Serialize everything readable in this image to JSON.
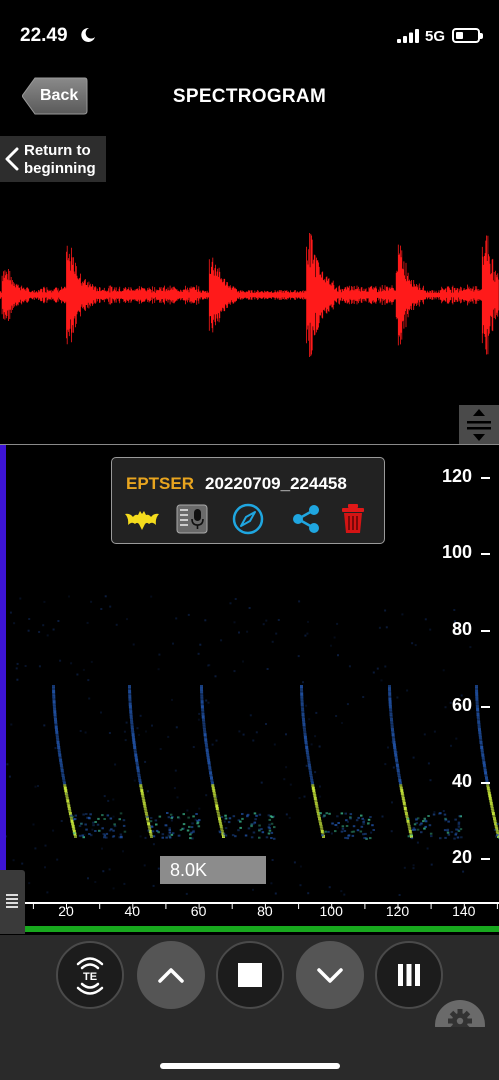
{
  "status_bar": {
    "time": "22.49",
    "network": "5G"
  },
  "nav": {
    "back_label": "Back",
    "title": "SPECTROGRAM"
  },
  "return_button": {
    "line1": "Return to",
    "line2": "beginning"
  },
  "recording": {
    "species_code": "EPTSER",
    "file_id": "20220709_224458",
    "actions": [
      "bat-icon",
      "recorder-icon",
      "compass-icon",
      "share-icon",
      "trash-icon"
    ]
  },
  "frequency_axis": {
    "labels": [
      "120",
      "100",
      "80",
      "60",
      "40",
      "20"
    ]
  },
  "sample_rate_label": "8.0K",
  "time_axis": {
    "labels": [
      "20",
      "40",
      "60",
      "80",
      "100",
      "120",
      "140"
    ]
  },
  "toolbar": {
    "buttons": [
      "te-listen-icon",
      "zoom-in-chevron-up-icon",
      "stop-icon",
      "zoom-out-chevron-down-icon",
      "columns-icon"
    ]
  },
  "colors": {
    "waveform": "#ff1a1a",
    "species_code": "#e9a51f",
    "spectrogram_low": "#1f4fa0",
    "spectrogram_high": "#c8e83a",
    "left_marker": "#3d14d6",
    "progress": "#18a81e"
  }
}
